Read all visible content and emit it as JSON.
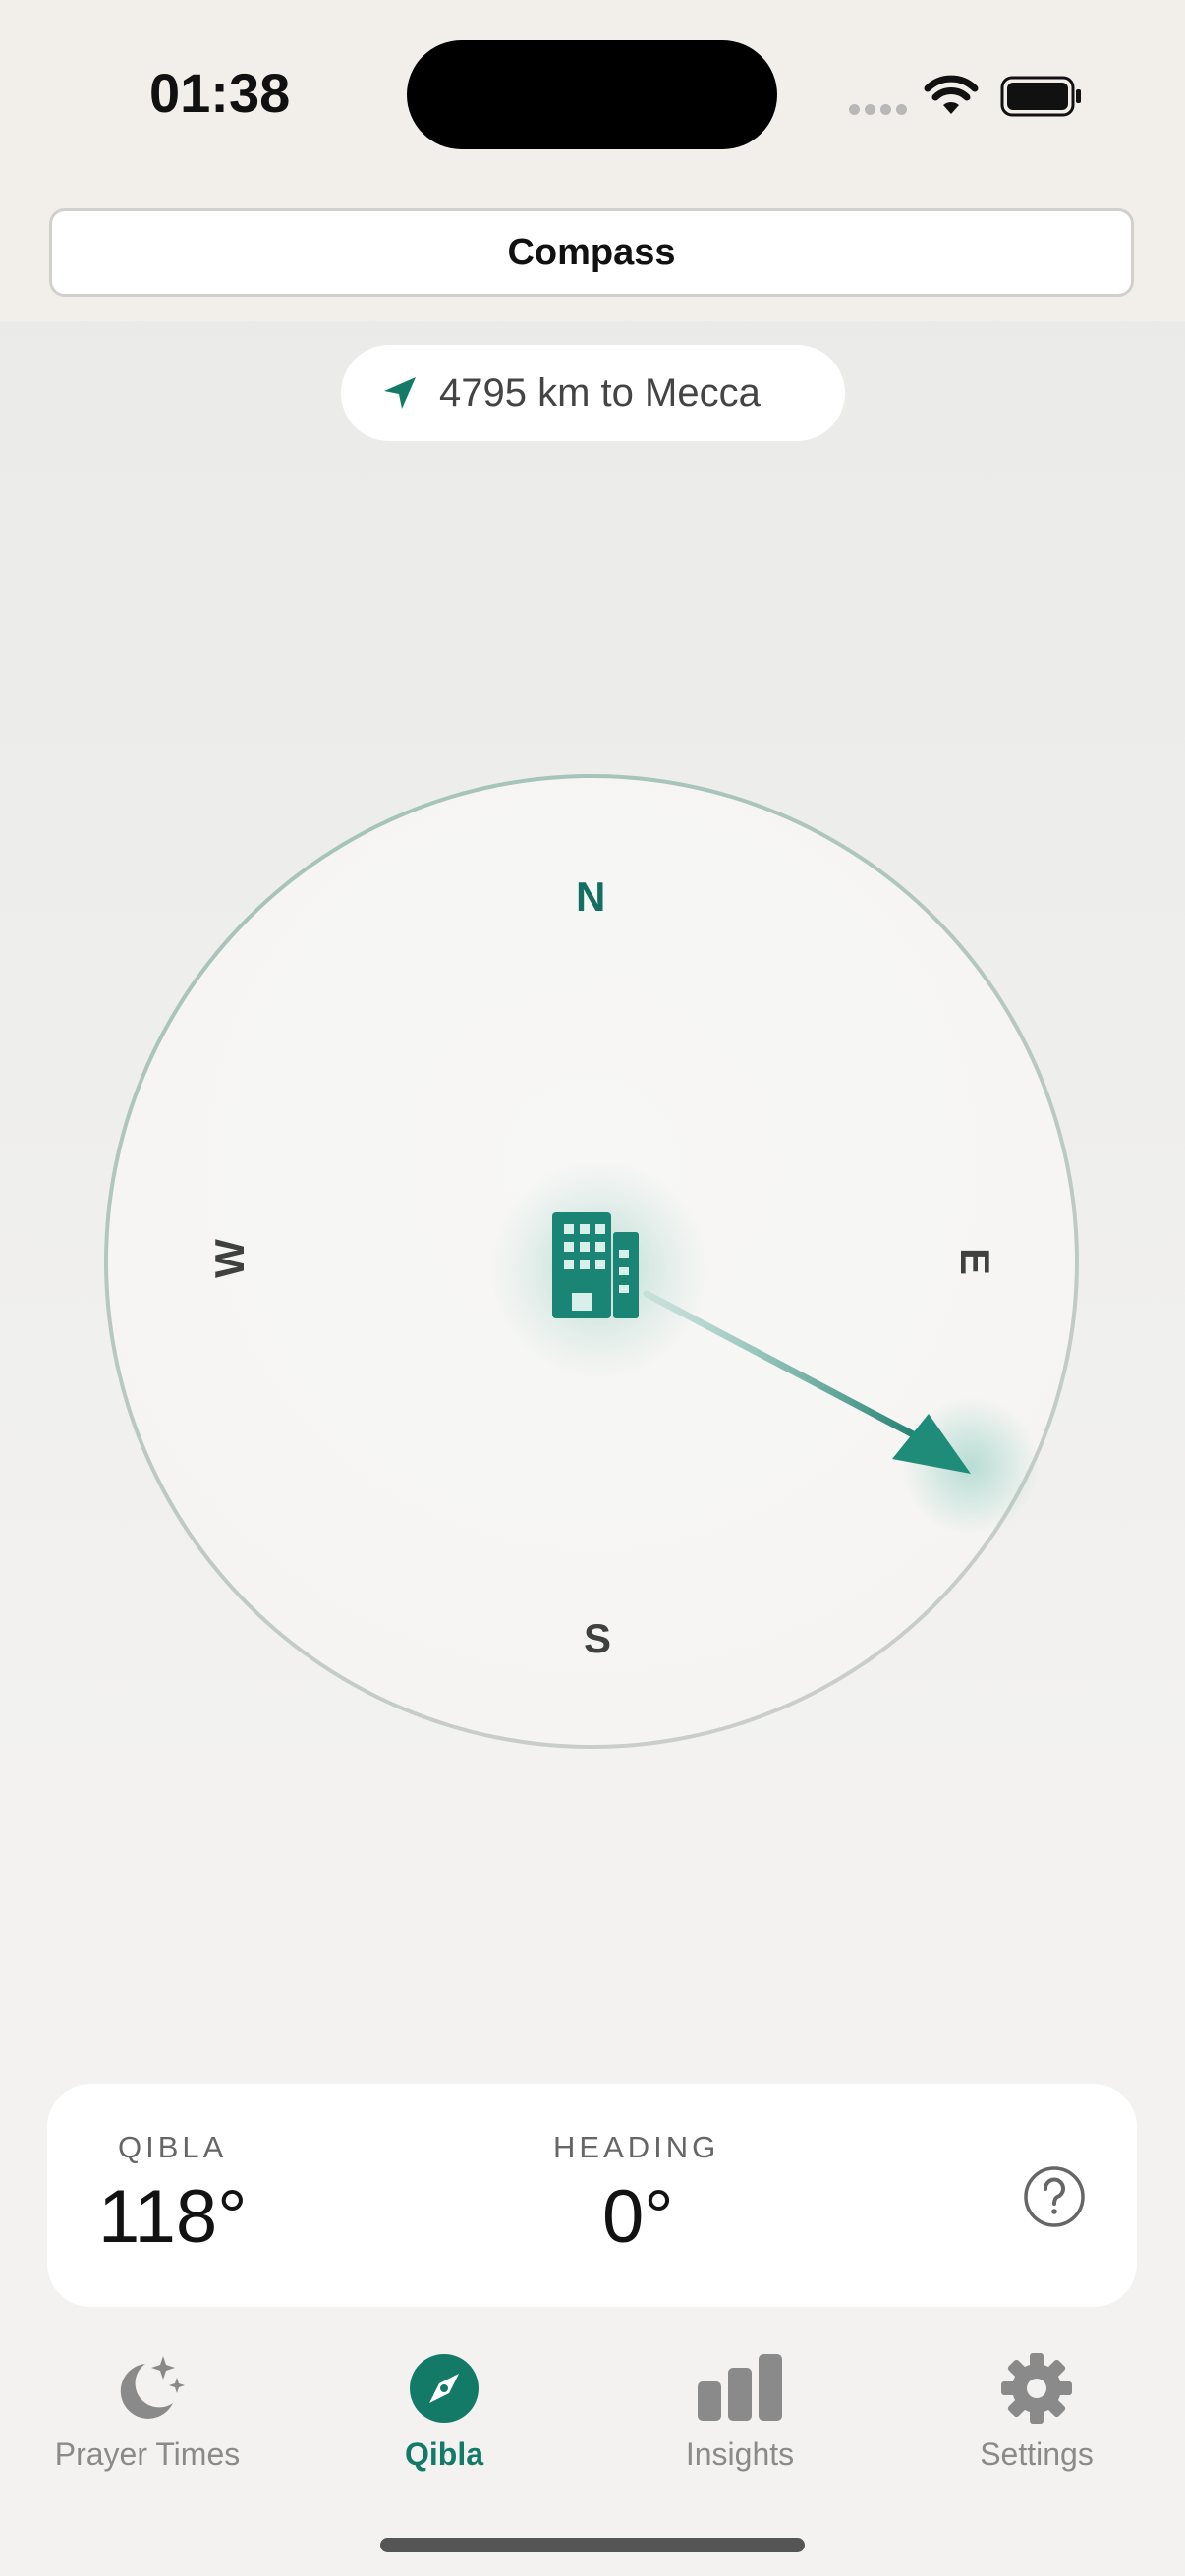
{
  "status_bar": {
    "time": "01:38"
  },
  "segmented_control": {
    "selected": "Compass"
  },
  "distance": {
    "text": "4795 km to Mecca"
  },
  "compass": {
    "north": "N",
    "east": "E",
    "south": "S",
    "west": "W",
    "qibla_bearing_deg": 118,
    "accent_color": "#147a68"
  },
  "info_card": {
    "qibla_label": "QIBLA",
    "qibla_value": "118°",
    "heading_label": "HEADING",
    "heading_value": "0°"
  },
  "tabs": [
    {
      "label": "Prayer Times",
      "icon": "moon-stars-icon",
      "active": false
    },
    {
      "label": "Qibla",
      "icon": "compass-icon",
      "active": true
    },
    {
      "label": "Insights",
      "icon": "bar-chart-icon",
      "active": false
    },
    {
      "label": "Settings",
      "icon": "gear-icon",
      "active": false
    }
  ]
}
